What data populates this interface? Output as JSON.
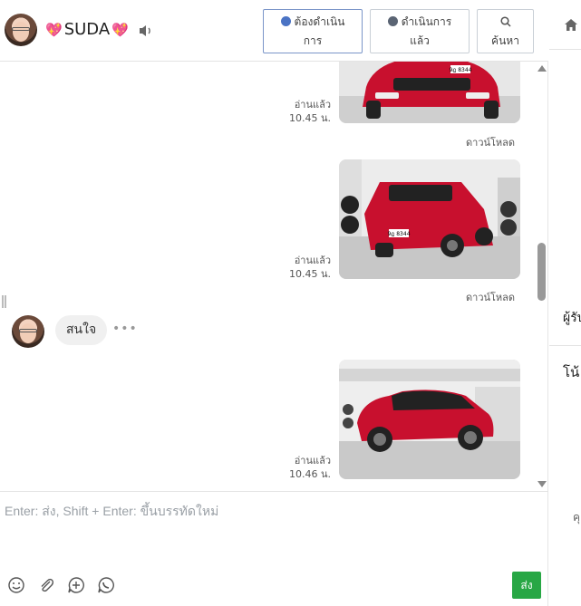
{
  "header": {
    "contact_name": "SUDA",
    "buttons": {
      "todo_line1": "ต้องดำเนิน",
      "todo_line2": "การ",
      "done_line1": "ดำเนินการ",
      "done_line2": "แล้ว",
      "search": "ค้นหา"
    }
  },
  "messages": [
    {
      "type": "outgoing-image",
      "read": "อ่านแล้ว",
      "time": "10.45 น.",
      "download": "ดาวน์โหลด",
      "plate": "9ฎ 8344"
    },
    {
      "type": "outgoing-image",
      "read": "อ่านแล้ว",
      "time": "10.45 น.",
      "download": "ดาวน์โหลด",
      "plate": "9ฎ 8344"
    },
    {
      "type": "incoming-text",
      "text": "สนใจ",
      "more": "•••"
    },
    {
      "type": "outgoing-image",
      "read": "อ่านแล้ว",
      "time": "10.46 น."
    }
  ],
  "composer": {
    "placeholder": "Enter: ส่ง, Shift + Enter: ขึ้นบรรทัดใหม่",
    "send_label": "ส่ง"
  },
  "side_panel": {
    "label_1": "ผู้รับ",
    "label_2": "โน้",
    "label_3": "คุ"
  },
  "colors": {
    "accent_blue": "#4a73c4",
    "send_green": "#28a745",
    "car_red": "#c8102e",
    "heart": "#e0306d"
  }
}
